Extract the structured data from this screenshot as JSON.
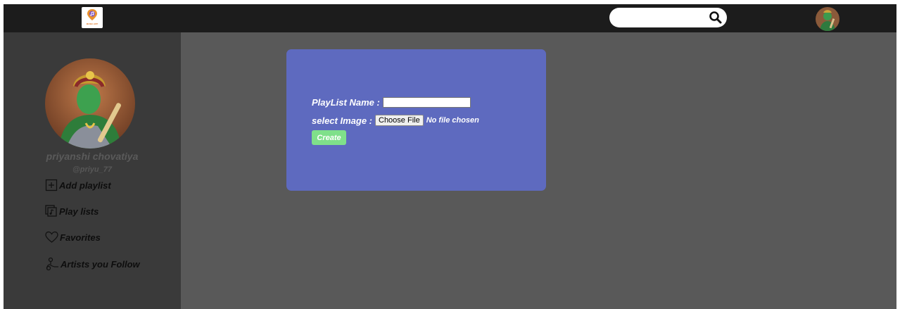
{
  "header": {
    "logo_text": "MUSIC APP",
    "logo_icon": "music-location-pin-logo",
    "search": {
      "placeholder": "",
      "value": "",
      "icon": "search-icon"
    },
    "avatar_icon": "avatar"
  },
  "sidebar": {
    "user_name": "priyanshi chovatiya",
    "user_handle": "@priyu_77",
    "items": [
      {
        "label": "Add playlist",
        "icon": "plus-square-icon"
      },
      {
        "label": "Play lists",
        "icon": "playlist-icon"
      },
      {
        "label": "Favorites",
        "icon": "heart-icon"
      },
      {
        "label": "Artists you Follow",
        "icon": "artist-icon"
      }
    ]
  },
  "form": {
    "name_label": "PlayList Name :",
    "name_value": "",
    "image_label": "select Image :",
    "choose_file_label": "Choose File",
    "no_file_text": "No file chosen",
    "create_label": "Create"
  },
  "colors": {
    "topbar": "#1c1c1c",
    "sidebar": "#3a3a3a",
    "main_bg": "#595959",
    "card": "#5e6abf",
    "create_button": "#7fe08a"
  }
}
